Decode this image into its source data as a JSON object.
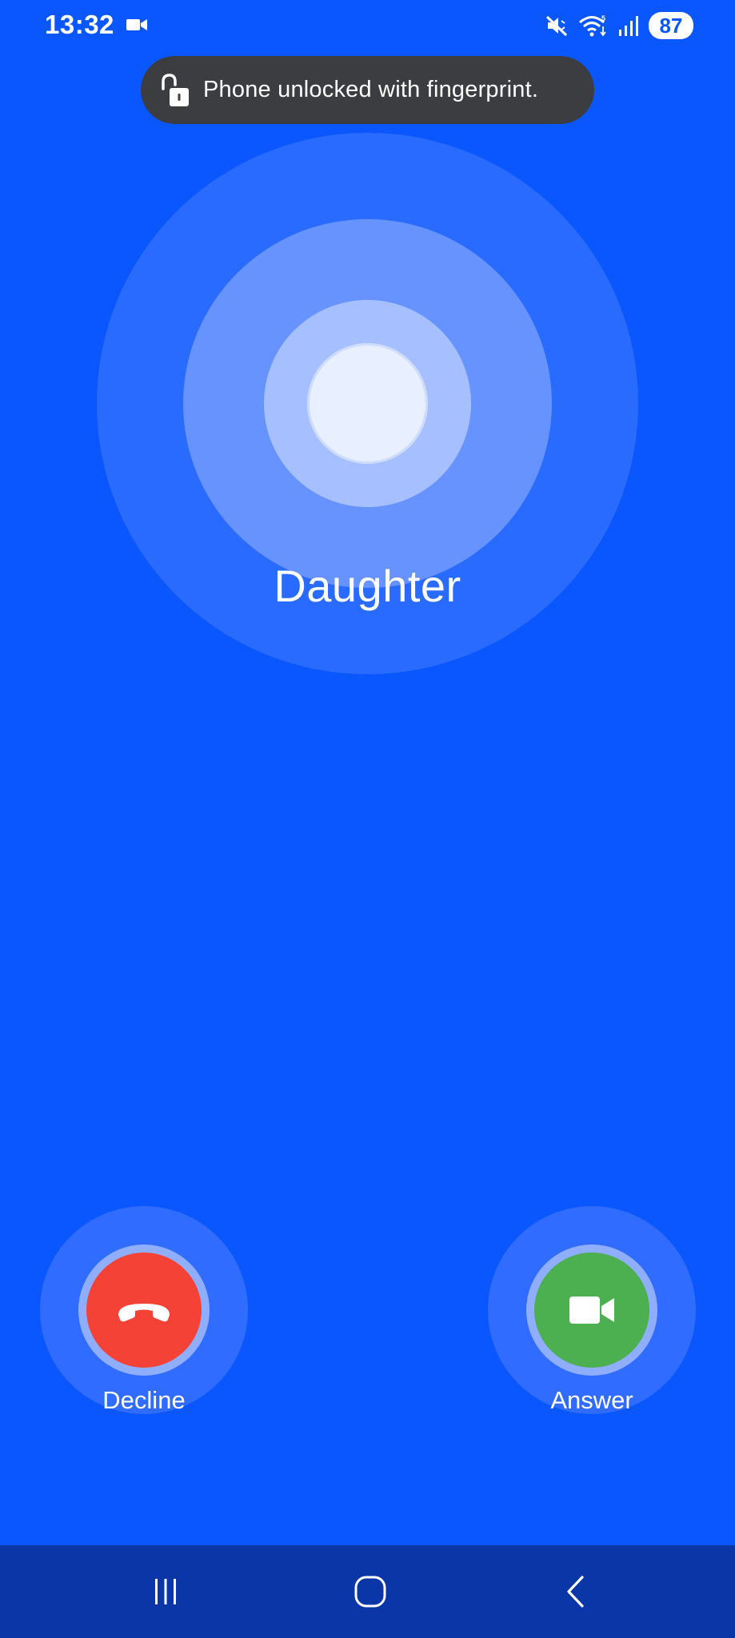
{
  "status_bar": {
    "time": "13:32",
    "battery": "87",
    "icons": [
      "video-camera-icon",
      "vibrate-mute-icon",
      "wifi-icon",
      "signal-icon",
      "battery-icon"
    ]
  },
  "toast": {
    "icon": "unlock-icon",
    "message": "Phone unlocked with fingerprint."
  },
  "call": {
    "caller_name": "Daughter",
    "decline": {
      "label": "Decline",
      "icon": "phone-hangup-icon",
      "color": "#f44336"
    },
    "answer": {
      "label": "Answer",
      "icon": "video-camera-icon",
      "color": "#4caf50"
    }
  },
  "nav_bar": {
    "buttons": [
      "recents-icon",
      "home-icon",
      "back-icon"
    ]
  },
  "colors": {
    "background": "#0b57ff",
    "nav_background": "#0a36a8",
    "toast_background": "#3c3d40"
  }
}
